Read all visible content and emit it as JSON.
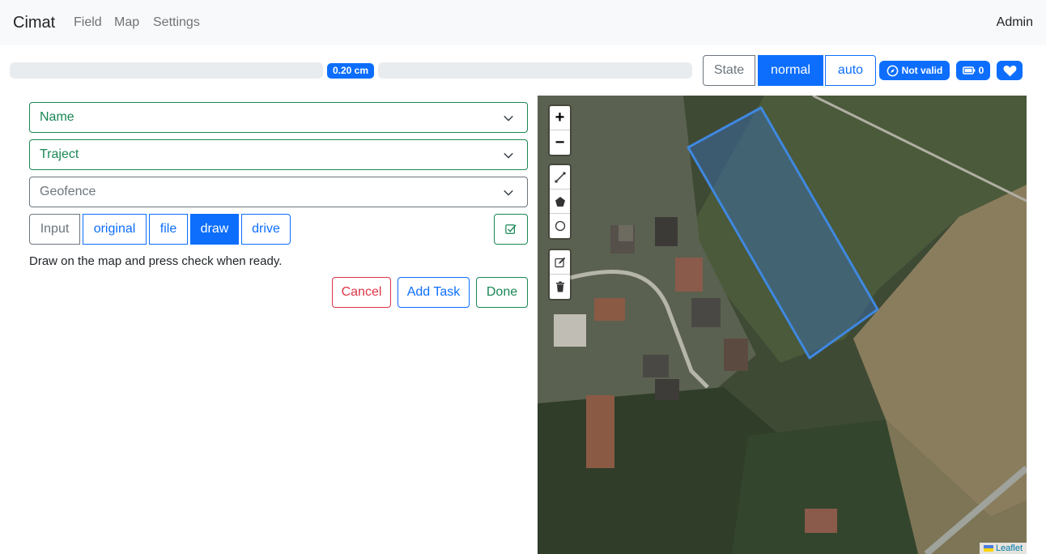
{
  "navbar": {
    "brand": "Cimat",
    "links": [
      "Field",
      "Map",
      "Settings"
    ],
    "user": "Admin"
  },
  "status": {
    "progress_label": "0.20 cm",
    "state_label": "State",
    "mode_normal": "normal",
    "mode_auto": "auto",
    "valid_label": "Not valid",
    "battery_count": "0",
    "accent_color": "#0d6efd",
    "icons": [
      "compass-icon",
      "battery-icon",
      "heart-icon"
    ]
  },
  "form": {
    "selects": [
      {
        "label": "Name",
        "status_color": "#198754"
      },
      {
        "label": "Traject",
        "status_color": "#198754"
      },
      {
        "label": "Geofence",
        "status_color": "#6c757d"
      }
    ],
    "input_label": "Input",
    "input_options": [
      "original",
      "file",
      "draw",
      "drive"
    ],
    "selected_option": "draw",
    "hint": "Draw on the map and press check when ready.",
    "actions": {
      "cancel": "Cancel",
      "add_task": "Add Task",
      "done": "Done"
    }
  },
  "map": {
    "zoom_in": "+",
    "zoom_out": "−",
    "draw_tools": [
      "polyline-icon",
      "polygon-icon",
      "circle-icon"
    ],
    "edit_tools": [
      "edit-icon",
      "trash-icon"
    ],
    "attribution": "Leaflet"
  }
}
